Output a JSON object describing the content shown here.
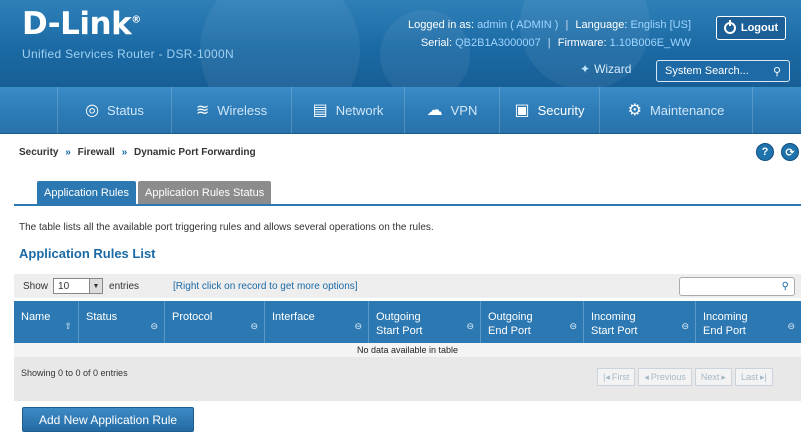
{
  "header": {
    "logo": "D-Link",
    "logo_mark": "®",
    "product": "Unified Services Router - DSR-1000N",
    "logged_in_label": "Logged in as:",
    "logged_in_value": "admin ( ADMIN )",
    "language_label": "Language:",
    "language_value": "English [US]",
    "serial_label": "Serial:",
    "serial_value": "QB2B1A3000007",
    "firmware_label": "Firmware:",
    "firmware_value": "1.10B006E_WW",
    "logout_label": "Logout",
    "wizard_label": "Wizard",
    "system_search_placeholder": "System Search..."
  },
  "nav": [
    {
      "label": "Status",
      "icon": "gauge-icon",
      "glyph": "◎"
    },
    {
      "label": "Wireless",
      "icon": "wifi-icon",
      "glyph": "≋"
    },
    {
      "label": "Network",
      "icon": "monitor-icon",
      "glyph": "▤"
    },
    {
      "label": "VPN",
      "icon": "cloud-icon",
      "glyph": "☁"
    },
    {
      "label": "Security",
      "icon": "lock-icon",
      "glyph": "▣"
    },
    {
      "label": "Maintenance",
      "icon": "gears-icon",
      "glyph": "⚙"
    }
  ],
  "breadcrumb": {
    "level1": "Security",
    "level2": "Firewall",
    "level3": "Dynamic Port Forwarding",
    "separator": "»"
  },
  "tabs": [
    {
      "label": "Application Rules",
      "active": true
    },
    {
      "label": "Application Rules Status",
      "active": false
    }
  ],
  "description": "The table lists all the available port triggering rules and allows several operations on the rules.",
  "list_title": "Application Rules List",
  "toolbar": {
    "show_label": "Show",
    "entries_value": "10",
    "entries_label": "entries",
    "right_click_hint": "[Right click on record to get more options]"
  },
  "table": {
    "columns": [
      {
        "line1": "Name",
        "line2": ""
      },
      {
        "line1": "Status",
        "line2": ""
      },
      {
        "line1": "Protocol",
        "line2": ""
      },
      {
        "line1": "Interface",
        "line2": ""
      },
      {
        "line1": "Outgoing",
        "line2": "Start Port"
      },
      {
        "line1": "Outgoing",
        "line2": "End Port"
      },
      {
        "line1": "Incoming",
        "line2": "Start Port"
      },
      {
        "line1": "Incoming",
        "line2": "End Port"
      }
    ],
    "empty_text": "No data available in table",
    "showing_text": "Showing 0 to 0 of 0 entries"
  },
  "pager": {
    "first": "First",
    "previous": "Previous",
    "next": "Next",
    "last": "Last"
  },
  "add_button": "Add New Application Rule",
  "help_button": "?",
  "refresh_button": "⟳"
}
